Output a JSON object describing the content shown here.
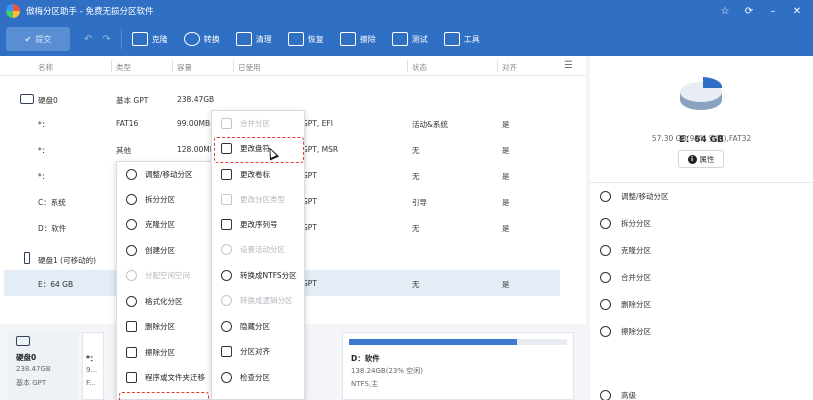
{
  "window": {
    "title": "傲梅分区助手 - 免费无损分区软件",
    "controls": [
      "☆",
      "⟳",
      "–",
      "✕"
    ]
  },
  "toolbar": {
    "submit": "提交",
    "tools": [
      "克隆",
      "转换",
      "清理",
      "恢复",
      "擦除",
      "测试",
      "工具"
    ]
  },
  "table": {
    "headers": [
      "名称",
      "类型",
      "容量",
      "已使用",
      "状态",
      "对齐"
    ],
    "rows": [
      {
        "name": "硬盘0",
        "type": "基本 GPT",
        "size": "238.47GB",
        "used": "",
        "fs": "",
        "status": "",
        "align": ""
      },
      {
        "name": "*：",
        "type": "FAT16",
        "size": "99.00MB",
        "used": "",
        "fs": "GPT, EFI",
        "status": "活动&系统",
        "align": "是"
      },
      {
        "name": "*：",
        "type": "其他",
        "size": "128.00MB",
        "used": "",
        "fs": "GPT, MSR",
        "status": "无",
        "align": "是"
      },
      {
        "name": "*：",
        "type": "",
        "size": "",
        "used": "",
        "fs": "GPT",
        "status": "无",
        "align": "是"
      },
      {
        "name": "C：系统",
        "type": "",
        "size": "",
        "used": "",
        "fs": "GPT",
        "status": "引导",
        "align": "是"
      },
      {
        "name": "D：软件",
        "type": "",
        "size": "",
        "used": "",
        "fs": "GPT",
        "status": "无",
        "align": "是"
      },
      {
        "name": "硬盘1 (可移动的)",
        "type": "",
        "size": "",
        "used": "",
        "fs": "",
        "status": "",
        "align": ""
      },
      {
        "name": "E：64 GB",
        "type": "",
        "size": "",
        "used": "",
        "fs": "GPT",
        "status": "无",
        "align": "是"
      }
    ]
  },
  "right_panel": {
    "name": "E：64 GB",
    "info": "57.30 GB(98% 空闲),FAT32",
    "properties_button": "属性",
    "actions": [
      "调整/移动分区",
      "拆分分区",
      "克隆分区",
      "合并分区",
      "删除分区",
      "擦除分区",
      "高级"
    ]
  },
  "bottom": {
    "disk0": {
      "name": "硬盘0",
      "size": "238.47GB",
      "type": "基本 GPT"
    },
    "mid_labels": [
      "*：",
      "9...",
      "F..."
    ],
    "partition_d": {
      "name": "D：软件",
      "info": "138.24GB(23% 空闲)",
      "fs": "NTFS,主",
      "used_fraction": 0.77
    }
  },
  "menu1": {
    "items": [
      {
        "label": "调整/移动分区",
        "icon": "resize-icon",
        "disabled": false
      },
      {
        "label": "拆分分区",
        "icon": "split-icon",
        "disabled": false
      },
      {
        "label": "克隆分区",
        "icon": "clone-icon",
        "disabled": false
      },
      {
        "label": "创建分区",
        "icon": "create-icon",
        "disabled": false
      },
      {
        "label": "分配空闲空间",
        "icon": "allocate-icon",
        "disabled": true
      },
      {
        "label": "格式化分区",
        "icon": "format-icon",
        "disabled": false
      },
      {
        "label": "删除分区",
        "icon": "delete-icon",
        "disabled": false
      },
      {
        "label": "擦除分区",
        "icon": "wipe-icon",
        "disabled": false
      },
      {
        "label": "程序或文件夹迁移",
        "icon": "migrate-icon",
        "disabled": false
      }
    ]
  },
  "menu2": {
    "items": [
      {
        "label": "合并分区",
        "icon": "merge-icon",
        "disabled": true
      },
      {
        "label": "更改盘符",
        "icon": "drive-letter-icon",
        "disabled": false
      },
      {
        "label": "更改卷标",
        "icon": "label-icon",
        "disabled": false
      },
      {
        "label": "更改分区类型",
        "icon": "id-icon",
        "disabled": true
      },
      {
        "label": "更改序列号",
        "icon": "serial-icon",
        "disabled": false
      },
      {
        "label": "设置活动分区",
        "icon": "active-icon",
        "disabled": true
      },
      {
        "label": "转换成NTFS分区",
        "icon": "convert-icon",
        "disabled": false
      },
      {
        "label": "转换成逻辑分区",
        "icon": "logical-icon",
        "disabled": true
      },
      {
        "label": "隐藏分区",
        "icon": "hide-icon",
        "disabled": false
      },
      {
        "label": "分区对齐",
        "icon": "align-icon",
        "disabled": false
      },
      {
        "label": "检查分区",
        "icon": "check-icon",
        "disabled": false
      }
    ]
  }
}
